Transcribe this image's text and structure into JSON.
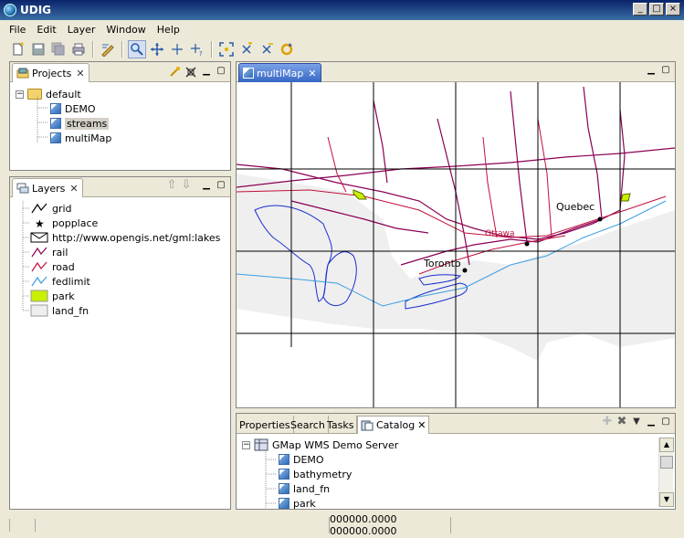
{
  "window": {
    "title": "UDIG"
  },
  "menu": [
    "File",
    "Edit",
    "Layer",
    "Window",
    "Help"
  ],
  "toolbar": {
    "buttons": [
      "new-icon",
      "save-icon",
      "save-all-icon",
      "print-icon",
      "edit-tool-icon",
      "zoom-icon",
      "pan-icon",
      "info-icon",
      "select-icon",
      "zoom-extent-icon",
      "zoom-in-icon",
      "zoom-out-icon",
      "refresh-icon"
    ]
  },
  "projects": {
    "tab_label": "Projects",
    "root": "default",
    "items": [
      "DEMO",
      "streams",
      "multiMap"
    ],
    "selected": "streams"
  },
  "layers": {
    "tab_label": "Layers",
    "items": [
      {
        "label": "grid",
        "symbol": "line",
        "color": "#000000"
      },
      {
        "label": "popplace",
        "symbol": "star",
        "color": "#000000"
      },
      {
        "label": "http://www.opengis.net/gml:lakes",
        "symbol": "envelope",
        "color": "#000000"
      },
      {
        "label": "rail",
        "symbol": "line",
        "color": "#8b0055"
      },
      {
        "label": "road",
        "symbol": "line",
        "color": "#c0103a"
      },
      {
        "label": "fedlimit",
        "symbol": "line",
        "color": "#3aa0e0"
      },
      {
        "label": "park",
        "symbol": "fill",
        "color": "#c8f000"
      },
      {
        "label": "land_fn",
        "symbol": "fill",
        "color": "#eeeeee"
      }
    ]
  },
  "map": {
    "tab_label": "multiMap",
    "city_labels": [
      "Quebec",
      "Ottawa",
      "Toronto"
    ]
  },
  "bottom_panel": {
    "tabs": [
      "Properties",
      "Search",
      "Tasks",
      "Catalog"
    ],
    "active_tab": "Catalog",
    "server": "GMap WMS Demo Server",
    "items": [
      "DEMO",
      "bathymetry",
      "land_fn",
      "park"
    ]
  },
  "status": {
    "coords": "000000.0000 000000.0000"
  }
}
